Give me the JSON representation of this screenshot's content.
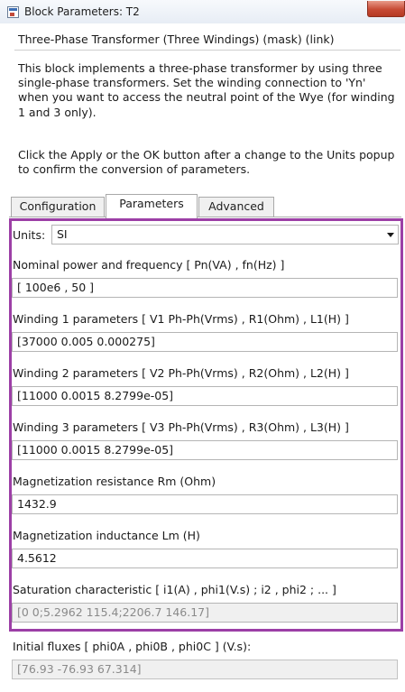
{
  "window": {
    "title": "Block Parameters: T2"
  },
  "mask": {
    "title": "Three-Phase Transformer (Three Windings) (mask) (link)",
    "description_lines": [
      "This block implements a three-phase transformer by using three",
      "single-phase transformers. Set the winding connection to 'Yn'",
      "when you want to access the neutral point of the Wye (for winding",
      "1 and 3 only)."
    ],
    "note_lines": [
      "Click the Apply or the OK button after a change to the Units popup",
      "to confirm the conversion of parameters."
    ]
  },
  "tabs": [
    {
      "label": "Configuration",
      "active": false
    },
    {
      "label": "Parameters",
      "active": true
    },
    {
      "label": "Advanced",
      "active": false
    }
  ],
  "units": {
    "label": "Units:",
    "value": "SI"
  },
  "params": [
    {
      "label": "Nominal power and frequency  [ Pn(VA) , fn(Hz) ]",
      "value": "[ 100e6 , 50 ]"
    },
    {
      "label": "Winding 1 parameters [ V1 Ph-Ph(Vrms) , R1(Ohm) , L1(H) ]",
      "value": "[37000 0.005 0.000275]"
    },
    {
      "label": "Winding 2 parameters [ V2 Ph-Ph(Vrms) , R2(Ohm) , L2(H) ]",
      "value": "[11000 0.0015 8.2799e-05]"
    },
    {
      "label": "Winding 3 parameters [ V3 Ph-Ph(Vrms) , R3(Ohm) , L3(H) ]",
      "value": "[11000 0.0015 8.2799e-05]"
    },
    {
      "label": "Magnetization resistance  Rm (Ohm)",
      "value": "1432.9"
    },
    {
      "label": "Magnetization inductance  Lm (H)",
      "value": "4.5612"
    },
    {
      "label": "Saturation characteristic [ i1(A) ,  phi1(V.s) ;  i2 , phi2 ; ... ]",
      "value": "[0 0;5.2962 115.4;2206.7 146.17]"
    }
  ],
  "initial_fluxes": {
    "label": "Initial fluxes [ phi0A , phi0B , phi0C ] (V.s):",
    "value": "[76.93 -76.93 67.314]"
  },
  "colors": {
    "highlight_border": "#9c3fa6",
    "close_button": "#c74b35"
  }
}
